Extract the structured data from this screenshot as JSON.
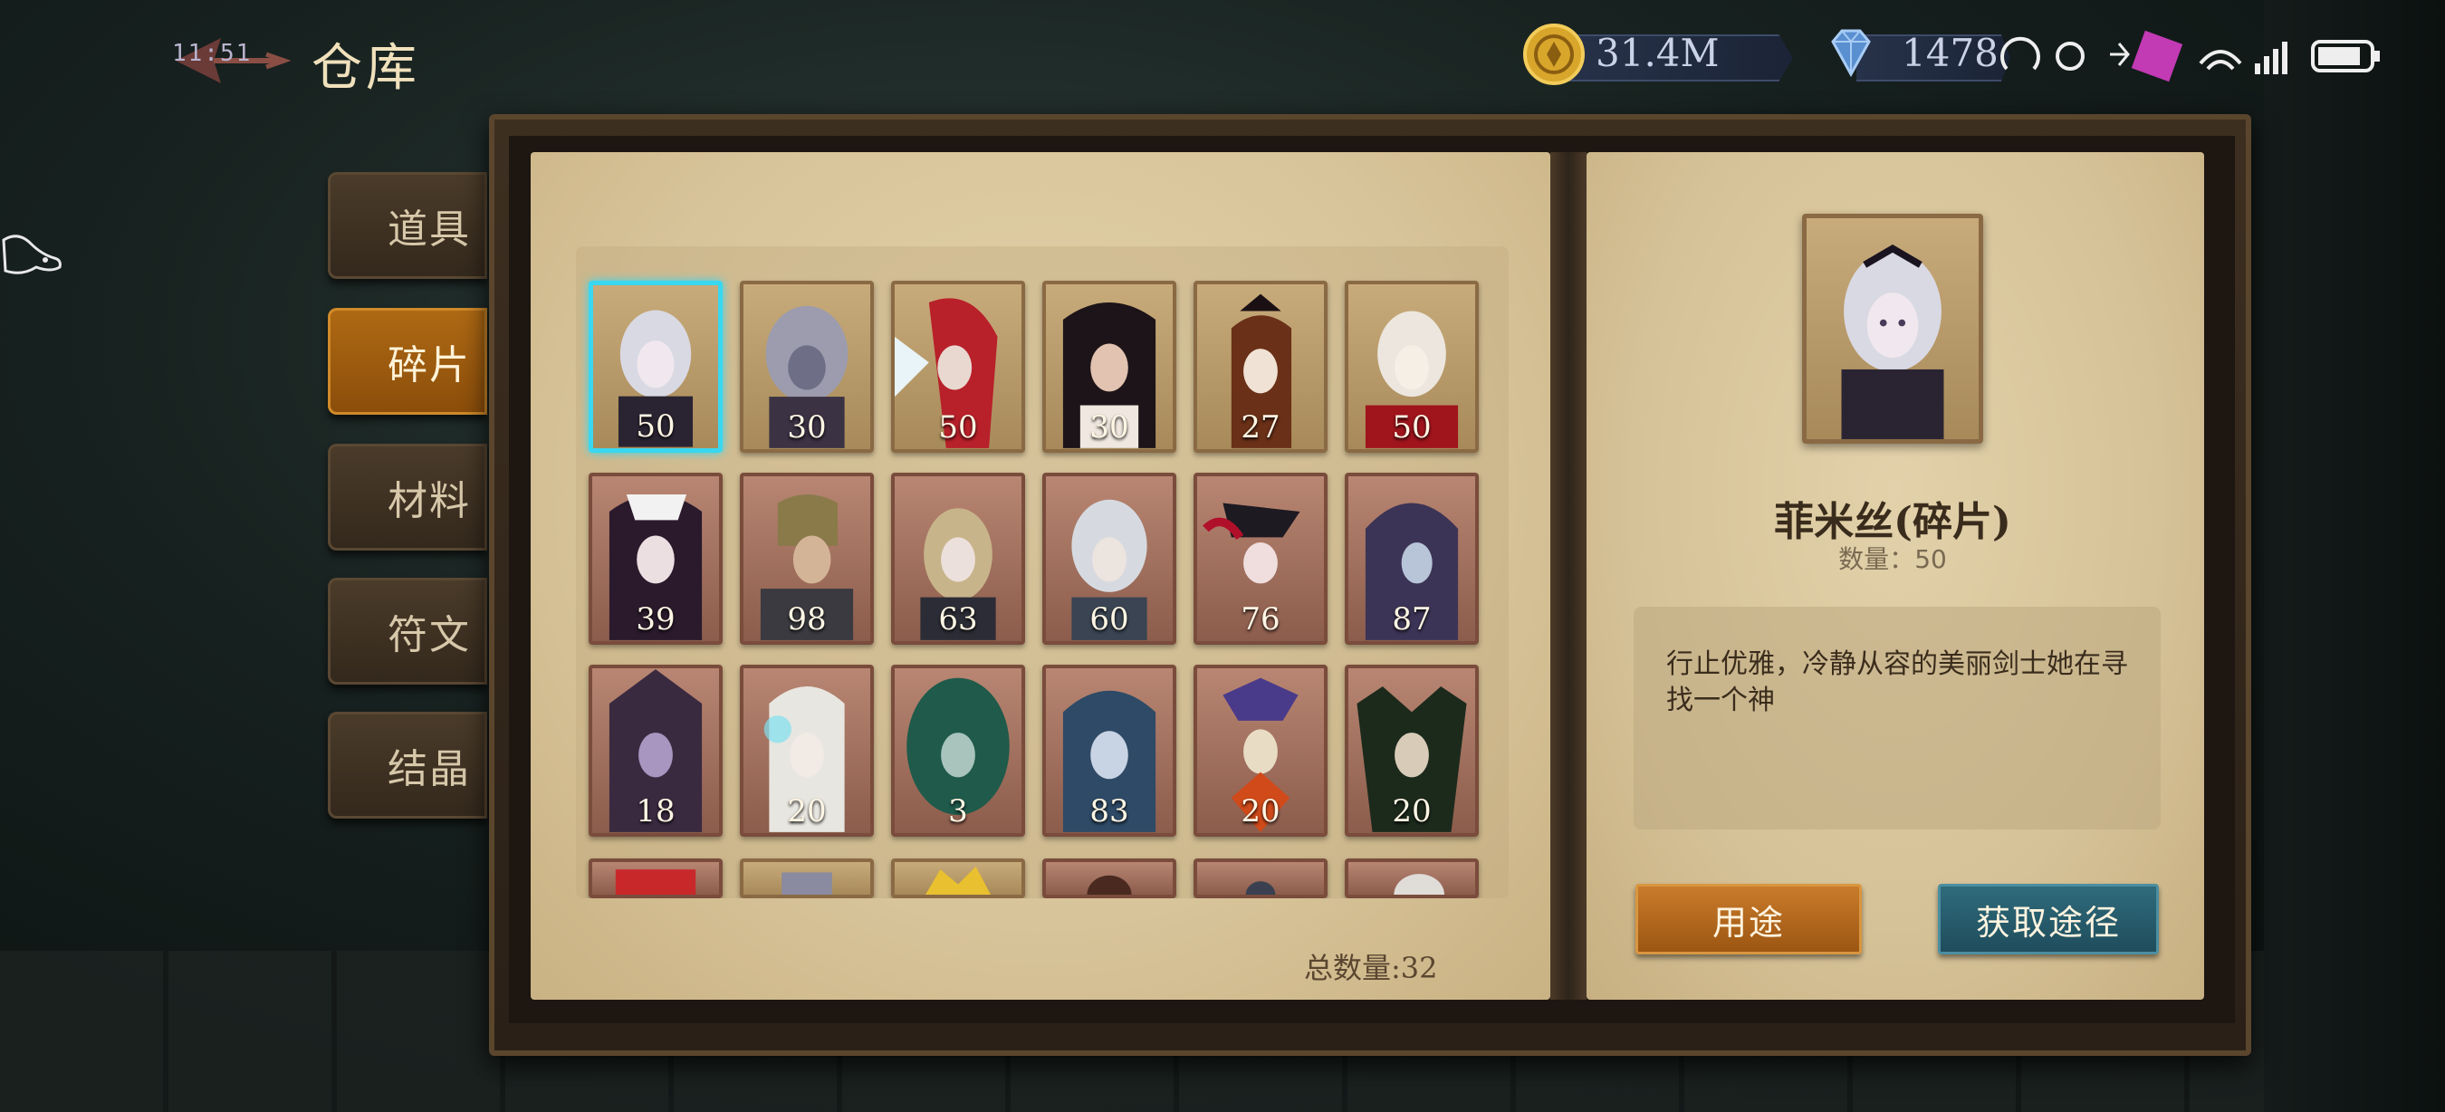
{
  "status_bar": {
    "time": "11:51"
  },
  "header": {
    "title": "仓库"
  },
  "resources": {
    "gold": "31.4M",
    "gems": "1478"
  },
  "tabs": [
    {
      "label": "道具",
      "active": false
    },
    {
      "label": "碎片",
      "active": true
    },
    {
      "label": "材料",
      "active": false
    },
    {
      "label": "符文",
      "active": false
    },
    {
      "label": "结晶",
      "active": false
    }
  ],
  "inventory": {
    "rows": [
      [
        "50",
        "30",
        "50",
        "30",
        "27",
        "50"
      ],
      [
        "39",
        "98",
        "63",
        "60",
        "76",
        "87"
      ],
      [
        "18",
        "20",
        "3",
        "83",
        "20",
        "20"
      ]
    ],
    "total_label": "总数量:32"
  },
  "detail": {
    "name": "菲米丝(碎片)",
    "quantity_label": "数量：",
    "quantity": "50",
    "description": "行止优雅，冷静从容的美丽剑士她在寻找一个神",
    "use_button": "用途",
    "source_button": "获取途径"
  },
  "colors": {
    "accent_selected": "#39d7f0",
    "tab_active": "#b06a14",
    "button_use": "#c97b2b",
    "button_source": "#2f6b7c"
  }
}
